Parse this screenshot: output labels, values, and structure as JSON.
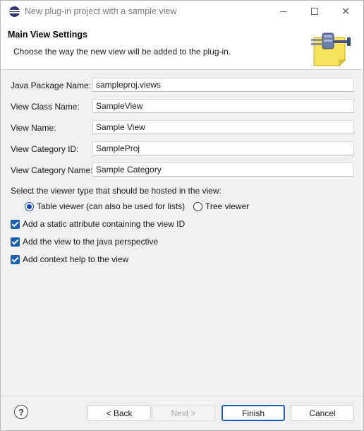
{
  "window": {
    "title": "New plug-in project with a sample view"
  },
  "header": {
    "title": "Main View Settings",
    "description": "Choose the way the new view will be added to the plug-in."
  },
  "form": {
    "fields": [
      {
        "label": "Java Package Name:",
        "value": "sampleproj.views"
      },
      {
        "label": "View Class Name:",
        "value": "SampleView"
      },
      {
        "label": "View Name:",
        "value": "Sample View"
      },
      {
        "label": "View Category ID:",
        "value": "SampleProj"
      },
      {
        "label": "View Category Name:",
        "value": "Sample Category"
      }
    ],
    "viewer_prompt": "Select the viewer type that should be hosted in the view:",
    "viewer_options": [
      {
        "label": "Table viewer (can also be used for lists)",
        "selected": true
      },
      {
        "label": "Tree viewer",
        "selected": false
      }
    ],
    "checkboxes": [
      {
        "label": "Add a static attribute containing the view ID",
        "checked": true
      },
      {
        "label": "Add the view to the java perspective",
        "checked": true
      },
      {
        "label": "Add context help to the view",
        "checked": true
      }
    ]
  },
  "footer": {
    "help_label": "?",
    "back_label": "< Back",
    "next_label": "Next >",
    "finish_label": "Finish",
    "cancel_label": "Cancel"
  },
  "colors": {
    "accent": "#1a5fb4"
  }
}
